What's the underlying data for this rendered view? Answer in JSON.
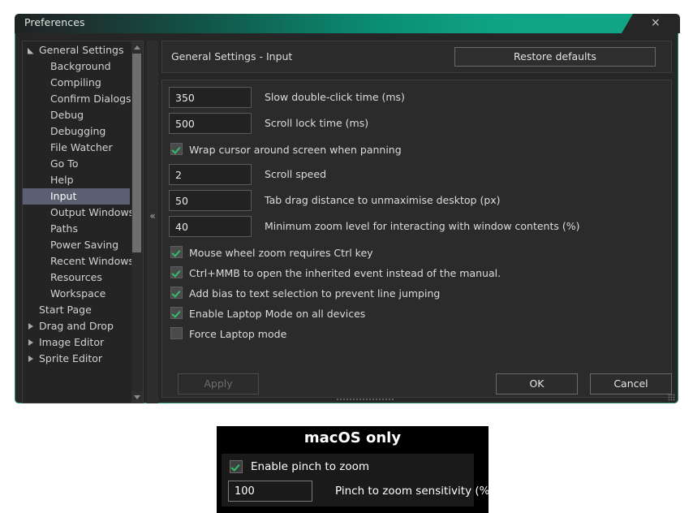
{
  "window": {
    "title": "Preferences",
    "close_icon": "×"
  },
  "sidebar": {
    "items": [
      {
        "label": "General Settings",
        "level": 1,
        "arrow": "expanded",
        "selected": false
      },
      {
        "label": "Background",
        "level": 2,
        "arrow": "none",
        "selected": false
      },
      {
        "label": "Compiling",
        "level": 2,
        "arrow": "none",
        "selected": false
      },
      {
        "label": "Confirm Dialogs",
        "level": 2,
        "arrow": "none",
        "selected": false
      },
      {
        "label": "Debug",
        "level": 2,
        "arrow": "none",
        "selected": false
      },
      {
        "label": "Debugging",
        "level": 2,
        "arrow": "none",
        "selected": false
      },
      {
        "label": "File Watcher",
        "level": 2,
        "arrow": "none",
        "selected": false
      },
      {
        "label": "Go To",
        "level": 2,
        "arrow": "none",
        "selected": false
      },
      {
        "label": "Help",
        "level": 2,
        "arrow": "none",
        "selected": false
      },
      {
        "label": "Input",
        "level": 2,
        "arrow": "none",
        "selected": true
      },
      {
        "label": "Output Windows",
        "level": 2,
        "arrow": "none",
        "selected": false
      },
      {
        "label": "Paths",
        "level": 2,
        "arrow": "none",
        "selected": false
      },
      {
        "label": "Power Saving",
        "level": 2,
        "arrow": "none",
        "selected": false
      },
      {
        "label": "Recent Windows",
        "level": 2,
        "arrow": "none",
        "selected": false
      },
      {
        "label": "Resources",
        "level": 2,
        "arrow": "none",
        "selected": false
      },
      {
        "label": "Workspace",
        "level": 2,
        "arrow": "none",
        "selected": false
      },
      {
        "label": "Start Page",
        "level": 1,
        "arrow": "none",
        "selected": false
      },
      {
        "label": "Drag and Drop",
        "level": 1,
        "arrow": "collapsed",
        "selected": false
      },
      {
        "label": "Image Editor",
        "level": 1,
        "arrow": "collapsed",
        "selected": false
      },
      {
        "label": "Sprite Editor",
        "level": 1,
        "arrow": "collapsed",
        "selected": false
      }
    ],
    "collapse_chevrons": "«"
  },
  "header": {
    "title": "General Settings - Input",
    "restore_defaults_label": "Restore defaults"
  },
  "settings": {
    "number_rows": [
      {
        "value": "350",
        "label": "Slow double-click time (ms)"
      },
      {
        "value": "500",
        "label": "Scroll lock time (ms)"
      },
      {
        "value": "2",
        "label": "Scroll speed"
      },
      {
        "value": "50",
        "label": "Tab drag distance to unmaximise desktop (px)"
      },
      {
        "value": "40",
        "label": "Minimum zoom level for interacting with window contents (%)"
      }
    ],
    "check_rows": [
      {
        "label": "Wrap cursor around screen when panning",
        "checked": true
      },
      {
        "label": "Mouse wheel zoom requires Ctrl key",
        "checked": true
      },
      {
        "label": "Ctrl+MMB to open the inherited event instead of the manual.",
        "checked": true
      },
      {
        "label": "Add bias to text selection to prevent line jumping",
        "checked": true
      },
      {
        "label": "Enable Laptop Mode on all devices",
        "checked": true
      },
      {
        "label": "Force Laptop mode",
        "checked": false
      }
    ]
  },
  "buttons": {
    "apply_label": "Apply",
    "ok_label": "OK",
    "cancel_label": "Cancel"
  },
  "macos_panel": {
    "title": "macOS only",
    "enable_pinch_label": "Enable pinch to zoom",
    "enable_pinch_checked": true,
    "sensitivity_value": "100",
    "sensitivity_label": "Pinch to zoom sensitivity (%)"
  },
  "colors": {
    "accent_teal": "#11a485",
    "border_teal": "#2b9172",
    "selection_blue": "#5a6072",
    "check_green": "#2fbd6d",
    "panel_bg": "#2b2b2b",
    "window_bg": "#262626"
  }
}
